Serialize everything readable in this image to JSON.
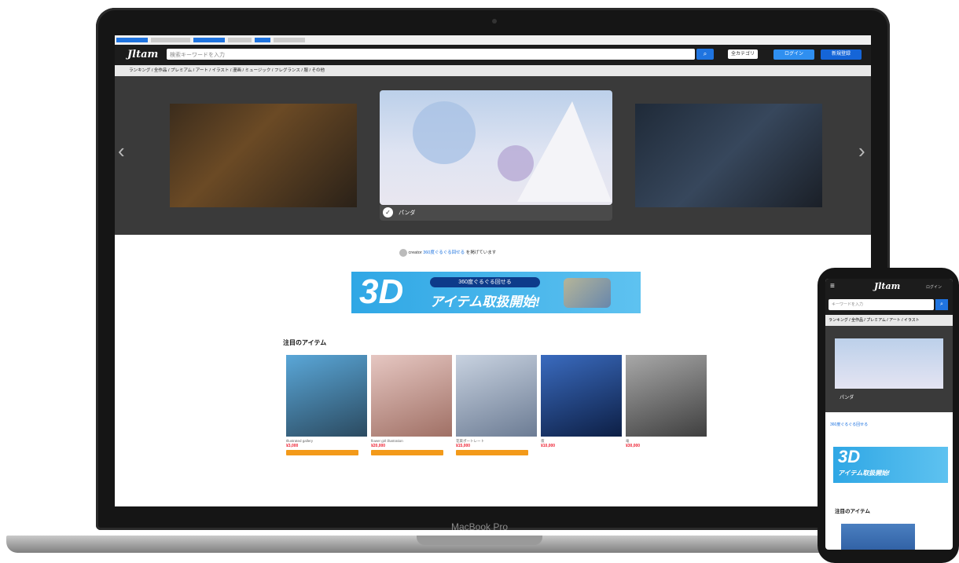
{
  "device": {
    "laptop_label": "MacBook Pro"
  },
  "site": {
    "logo": "Jltam",
    "search_placeholder": "検索キーワードを入力",
    "search_icon": "magnifier",
    "category_select": "全カテゴリ",
    "login_label": "ログイン",
    "register_label": "新規登録",
    "categories": "ランキング / 全作品 / プレミアム / アート / イラスト / 漫画 / ミュージック / フレグランス / 服 / その他"
  },
  "hero": {
    "caption": "パンダ",
    "prev_icon": "chevron-left",
    "next_icon": "chevron-right",
    "creator_name": "creator",
    "creator_link": "360度ぐるぐる回せる",
    "creator_text": "を掲げています"
  },
  "banner": {
    "big": "3D",
    "pill": "360度ぐるぐる回せる",
    "main": "アイテム取扱開始!"
  },
  "section_title": "注目のアイテム",
  "items": [
    {
      "title": "Illustrated gallery",
      "price": "¥3,000",
      "color_a": "#5aa7d8",
      "color_b": "#2b4a60"
    },
    {
      "title": "flower girl illustration",
      "price": "¥20,000",
      "color_a": "#e6c7c2",
      "color_b": "#a07065"
    },
    {
      "title": "花束ポートレート",
      "price": "¥15,000",
      "color_a": "#c8d2e0",
      "color_b": "#6c7c94"
    },
    {
      "title": "夜",
      "price": "¥10,000",
      "color_a": "#3a6bbf",
      "color_b": "#0d1f45"
    },
    {
      "title": "竜",
      "price": "¥30,000",
      "color_a": "#a8a8a8",
      "color_b": "#3f3f3f"
    }
  ],
  "phone": {
    "logo": "Jltam",
    "login": "ログイン",
    "search_placeholder": "キーワードを入力",
    "categories": "ランキング / 全作品 / プレミアム / アート / イラスト",
    "caption": "パンダ",
    "creator_link": "360度ぐるぐる回せる",
    "banner_big": "3D",
    "banner_sub": "アイテム取扱開始!",
    "section_title": "注目のアイテム"
  }
}
